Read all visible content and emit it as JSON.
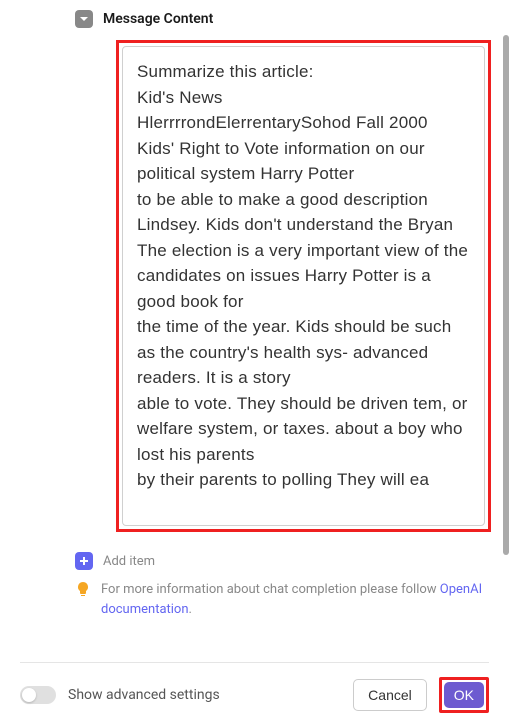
{
  "section": {
    "title": "Message Content"
  },
  "message_content": "Summarize this article:\nKid's News\nHlerrrrondElerrentarySohod Fall 2000\nKids' Right to Vote information on our political system Harry Potter\nto be able to make a good description Lindsey. Kids don't understand the Bryan\nThe election is a very important view of the candidates on issues Harry Potter is a good book for\nthe time of the year. Kids should be such as the country's health sys- advanced readers. It is a story\nable to vote. They should be driven tem, or welfare system, or taxes. about a boy who lost his parents\nby their parents to polling They will ea",
  "add_item": {
    "label": "Add item"
  },
  "help": {
    "text_before": "For more information about chat completion please follow ",
    "link_text": "OpenAI documentation",
    "text_after": "."
  },
  "footer": {
    "toggle_label": "Show advanced settings",
    "cancel_label": "Cancel",
    "ok_label": "OK"
  }
}
